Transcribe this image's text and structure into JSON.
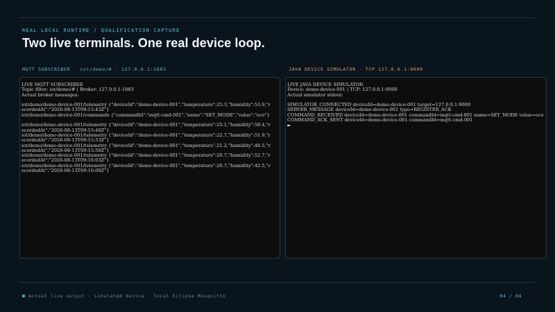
{
  "header": {
    "eyebrow": "REAL LOCAL RUNTIME / QUALIFICATION CAPTURE",
    "title": "Two live terminals. One real device loop."
  },
  "left_panel": {
    "label": "MQTT SUBSCRIBER · iot/demo/# · 127.0.0.1:1883",
    "lines": [
      "LIVE MQTT SUBSCRIBER",
      "Topic filter: iot/demo/# | Broker: 127.0.0.1:1883",
      "Actual broker messages:",
      "",
      "iot/demo/demo-device-001/telemetry {\"deviceId\":\"demo-device-001\",\"temperature\":25.3,\"humidity\":53.9,\"r",
      "ecordedAt\":\"2026-08-13T09:15:43Z\"}",
      "iot/demo/demo-device-001/commands {\"commandId\":\"mqtt-cmd-001\",\"name\":\"SET_MODE\",\"value\":\"eco\"}",
      "",
      "iot/demo/demo-device-001/telemetry {\"deviceId\":\"demo-device-001\",\"temperature\":25.1,\"humidity\":58.4,\"r",
      "ecordedAt\":\"2026-08-13T09:15:48Z\"}",
      "iot/demo/demo-device-001/telemetry {\"deviceId\":\"demo-device-001\",\"temperature\":22.7,\"humidity\":51.9,\"r",
      "ecordedAt\":\"2026-08-13T09:15:53Z\"}",
      "iot/demo/demo-device-001/telemetry {\"deviceId\":\"demo-device-001\",\"temperature\":21.2,\"humidity\":48.5,\"r",
      "ecordedAt\":\"2026-08-13T09:15:58Z\"}",
      "iot/demo/demo-device-001/telemetry {\"deviceId\":\"demo-device-001\",\"temperature\":20.7,\"humidity\":52.7,\"r",
      "ecordedAt\":\"2026-08-13T09:16:03Z\"}",
      "iot/demo/demo-device-001/telemetry {\"deviceId\":\"demo-device-001\",\"temperature\":20.7,\"humidity\":42.5,\"r",
      "ecordedAt\":\"2026-08-13T09:16:08Z\"}"
    ]
  },
  "right_panel": {
    "label": "JAVA DEVICE SIMULATOR · TCP 127.0.0.1:9000",
    "lines": [
      "LIVE JAVA DEVICE SIMULATOR",
      "Device: demo-device-001 | TCP: 127.0.0.1:9000",
      "Actual simulator stdout:",
      "",
      "SIMULATOR_CONNECTED deviceId=demo-device-001 target=127.0.0.1:9000",
      "SERVER_MESSAGE deviceId=demo-device-001 type=REGISTER_ACK",
      "COMMAND_RECEIVED deviceId=demo-device-001 commandId=mqtt-cmd-001 name=SET_MODE value=eco",
      "COMMAND_ACK_SENT deviceId=demo-device-001 commandId=mqtt-cmd-001"
    ]
  },
  "footer": {
    "caption": "Actual live output · simulated device · local Eclipse Mosquitto",
    "page": "04 / 04"
  },
  "colors": {
    "background": "#0a141c",
    "accent_cyan": "#58c4d8",
    "accent_orange": "#e8a860",
    "status_green": "#3fd1a8",
    "terminal_bg": "#0d0d0d"
  }
}
